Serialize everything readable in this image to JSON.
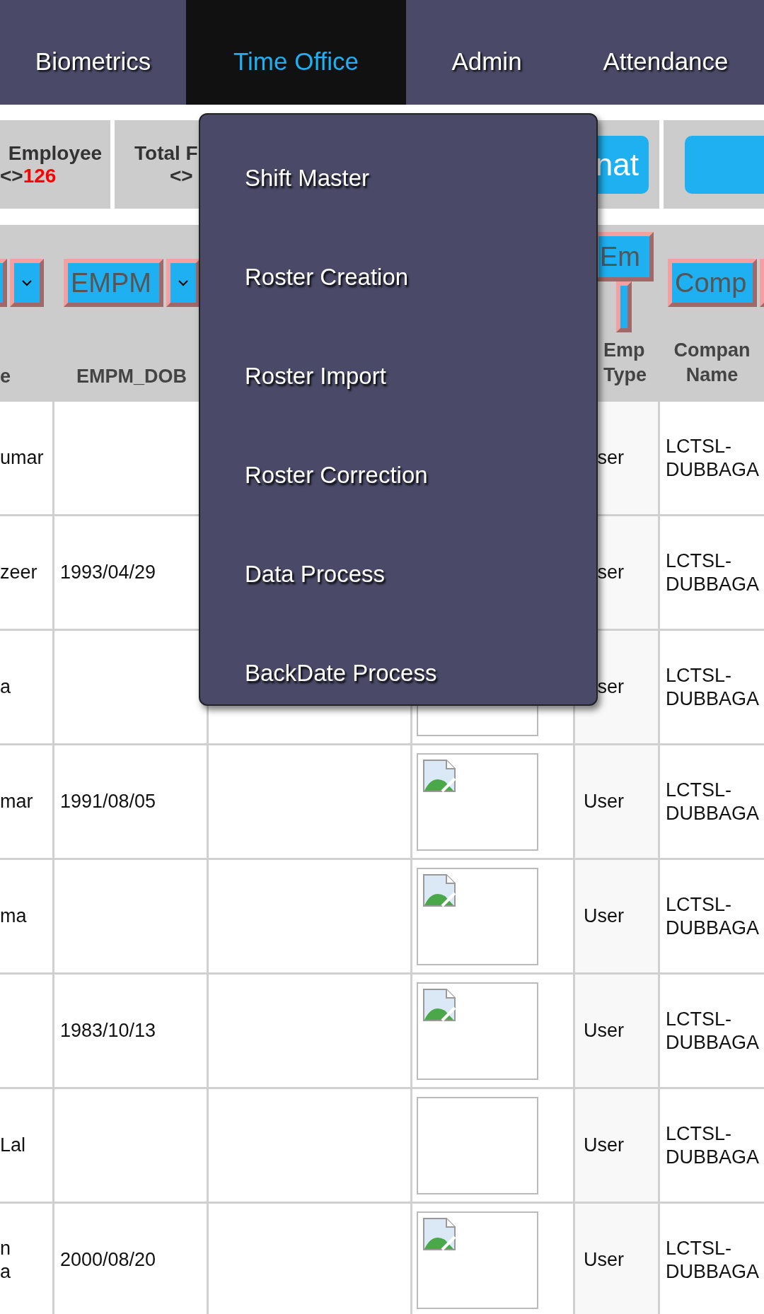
{
  "nav": {
    "tabs": [
      {
        "label": "Biometrics",
        "selected": false
      },
      {
        "label": "Time Office",
        "selected": true
      },
      {
        "label": "Admin",
        "selected": false
      },
      {
        "label": "Attendance",
        "selected": false
      }
    ]
  },
  "stats": [
    {
      "kind": "count",
      "label": "Employee",
      "prefix": "<>",
      "value": "126"
    },
    {
      "kind": "count",
      "label": "Total F",
      "prefix": "<>"
    },
    {
      "kind": "button",
      "label": "nat"
    },
    {
      "kind": "button"
    }
  ],
  "table": {
    "columns": [
      {
        "label": "e",
        "filter": {
          "kind": "select"
        }
      },
      {
        "label": "EMPM_DOB",
        "filter": {
          "kind": "select",
          "placeholder": "EMPM"
        }
      },
      {},
      {},
      {
        "label": "Emp Type",
        "filter": {
          "kind": "stacked",
          "placeholder": "Em"
        }
      },
      {
        "label": "Compan Name",
        "filter": {
          "kind": "select_cut",
          "placeholder": "Comp"
        }
      }
    ],
    "rows": [
      {
        "name": "umar",
        "emp_type": "ser",
        "company": "LCTSL- DUBBAGA"
      },
      {
        "name": "zeer",
        "dob": "1993/04/29",
        "emp_type": "ser",
        "company": "LCTSL- DUBBAGA"
      },
      {
        "name": "a",
        "photo": {
          "kind": "blank"
        },
        "emp_type": "ser",
        "company": "LCTSL- DUBBAGA"
      },
      {
        "name": "mar",
        "dob": "1991/08/05",
        "photo": {
          "kind": "broken"
        },
        "emp_type": "User",
        "company": "LCTSL- DUBBAGA"
      },
      {
        "name": "ma",
        "photo": {
          "kind": "broken"
        },
        "emp_type": "User",
        "company": "LCTSL- DUBBAGA"
      },
      {
        "dob": "1983/10/13",
        "photo": {
          "kind": "broken"
        },
        "emp_type": "User",
        "company": "LCTSL- DUBBAGA"
      },
      {
        "name": "Lal",
        "photo": {
          "kind": "blank"
        },
        "emp_type": "User",
        "company": "LCTSL- DUBBAGA"
      },
      {
        "name": "n\na",
        "dob": "2000/08/20",
        "photo": {
          "kind": "broken"
        },
        "emp_type": "User",
        "company": "LCTSL- DUBBAGA"
      }
    ]
  },
  "menu": {
    "items": [
      {
        "label": "Shift Master"
      },
      {
        "label": "Roster Creation"
      },
      {
        "label": "Roster Import"
      },
      {
        "label": "Roster Correction"
      },
      {
        "label": "Data Process"
      },
      {
        "label": "BackDate Process"
      }
    ]
  }
}
